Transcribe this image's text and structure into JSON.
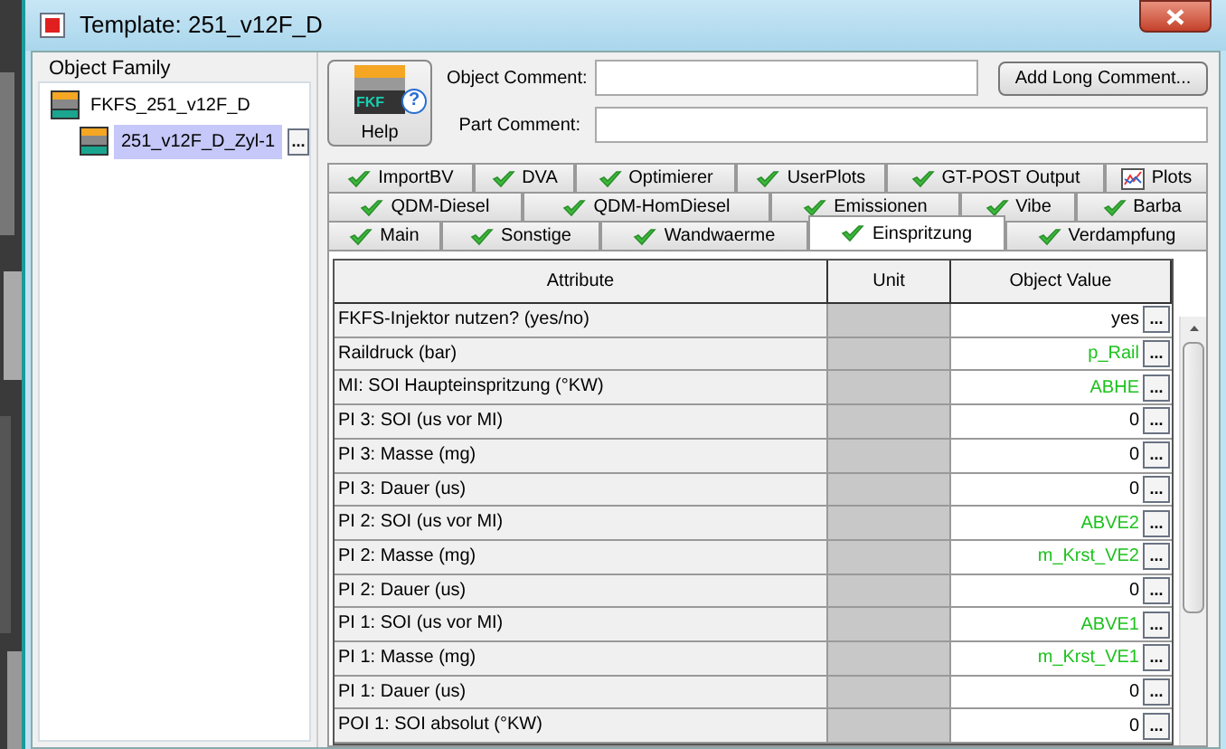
{
  "window": {
    "title": "Template: 251_v12F_D"
  },
  "object_family": {
    "label": "Object Family",
    "tree": [
      {
        "label": "FKFS_251_v12F_D",
        "selected": false,
        "children": [
          {
            "label": "251_v12F_D_Zyl-1",
            "selected": true,
            "more": "..."
          }
        ]
      }
    ]
  },
  "help_button": {
    "label": "Help",
    "icon_text": "FKF",
    "badge": "?"
  },
  "object_comment": {
    "label": "Object Comment:"
  },
  "add_long_comment": "Add Long Comment...",
  "part_comment": {
    "label": "Part Comment:"
  },
  "tab_rows": [
    [
      {
        "label": "ImportBV",
        "kind": "check",
        "selected": false
      },
      {
        "label": "DVA",
        "kind": "check",
        "selected": false
      },
      {
        "label": "Optimierer",
        "kind": "check",
        "selected": false
      },
      {
        "label": "UserPlots",
        "kind": "check",
        "selected": false
      },
      {
        "label": "GT-POST Output",
        "kind": "check",
        "selected": false
      },
      {
        "label": "Plots",
        "kind": "plot",
        "selected": false
      }
    ],
    [
      {
        "label": "QDM-Diesel",
        "kind": "check",
        "selected": false
      },
      {
        "label": "QDM-HomDiesel",
        "kind": "check",
        "selected": false
      },
      {
        "label": "Emissionen",
        "kind": "check",
        "selected": false
      },
      {
        "label": "Vibe",
        "kind": "check",
        "selected": false
      },
      {
        "label": "Barba",
        "kind": "check",
        "selected": false
      }
    ],
    [
      {
        "label": "Main",
        "kind": "check",
        "selected": false
      },
      {
        "label": "Sonstige",
        "kind": "check",
        "selected": false
      },
      {
        "label": "Wandwaerme",
        "kind": "check",
        "selected": false
      },
      {
        "label": "Einspritzung",
        "kind": "check",
        "selected": true
      },
      {
        "label": "Verdampfung",
        "kind": "check",
        "selected": false
      }
    ]
  ],
  "table": {
    "columns": [
      "Attribute",
      "Unit",
      "Object Value"
    ],
    "rows": [
      {
        "attribute": "FKFS-Injektor nutzen? (yes/no)",
        "value": "yes",
        "linked": false
      },
      {
        "attribute": "Raildruck (bar)",
        "value": "p_Rail",
        "linked": true
      },
      {
        "attribute": "MI: SOI Haupteinspritzung (°KW)",
        "value": "ABHE",
        "linked": true
      },
      {
        "attribute": "PI 3: SOI  (us vor MI)",
        "value": "0",
        "linked": false
      },
      {
        "attribute": "PI 3: Masse (mg)",
        "value": "0",
        "linked": false
      },
      {
        "attribute": "PI 3: Dauer (us)",
        "value": "0",
        "linked": false
      },
      {
        "attribute": "PI 2: SOI  (us vor MI)",
        "value": "ABVE2",
        "linked": true
      },
      {
        "attribute": "PI 2: Masse (mg)",
        "value": "m_Krst_VE2",
        "linked": true
      },
      {
        "attribute": "PI 2: Dauer (us)",
        "value": "0",
        "linked": false
      },
      {
        "attribute": "PI 1: SOI  (us vor MI)",
        "value": "ABVE1",
        "linked": true
      },
      {
        "attribute": "PI 1: Masse (mg)",
        "value": "m_Krst_VE1",
        "linked": true
      },
      {
        "attribute": "PI 1: Dauer (us)",
        "value": "0",
        "linked": false
      },
      {
        "attribute": "POI 1: SOI  absolut (°KW)",
        "value": "0",
        "linked": false
      }
    ],
    "more_button": "..."
  }
}
